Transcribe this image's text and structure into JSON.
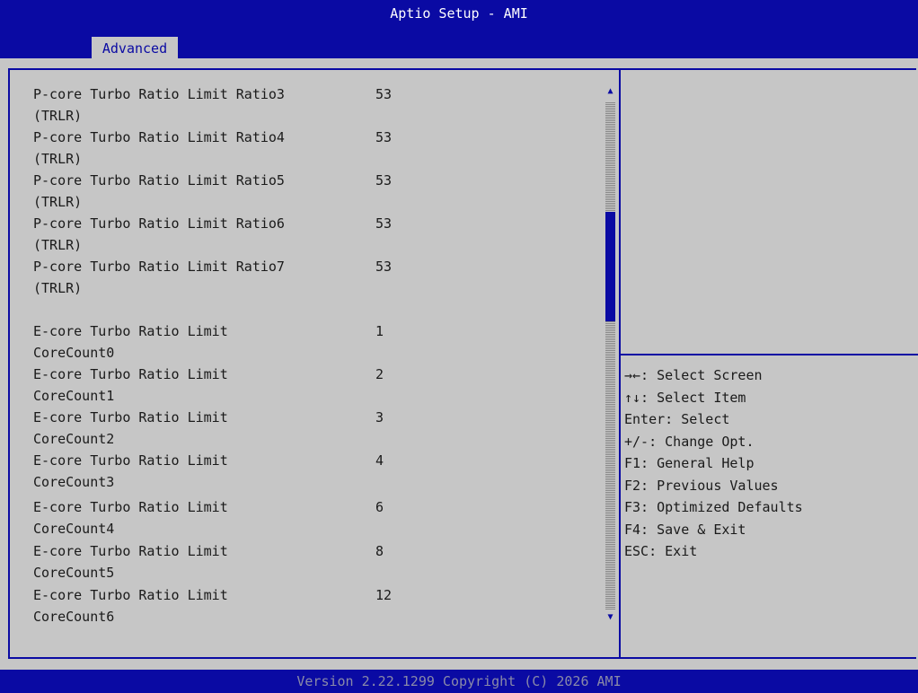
{
  "window": {
    "title": "Aptio Setup - AMI"
  },
  "tabs": [
    {
      "label": "Advanced"
    }
  ],
  "settings": [
    {
      "label": "P-core Turbo Ratio Limit Ratio3\n(TRLR)",
      "value": "53"
    },
    {
      "label": "P-core Turbo Ratio Limit Ratio4\n(TRLR)",
      "value": "53"
    },
    {
      "label": "P-core Turbo Ratio Limit Ratio5\n(TRLR)",
      "value": "53"
    },
    {
      "label": "P-core Turbo Ratio Limit Ratio6\n(TRLR)",
      "value": "53"
    },
    {
      "label": "P-core Turbo Ratio Limit Ratio7\n(TRLR)",
      "value": "53"
    },
    {
      "label": "E-core Turbo Ratio Limit\nCoreCount0",
      "value": "1"
    },
    {
      "label": "E-core Turbo Ratio Limit\nCoreCount1",
      "value": "2"
    },
    {
      "label": "E-core Turbo Ratio Limit\nCoreCount2",
      "value": "3"
    },
    {
      "label": "E-core Turbo Ratio Limit\nCoreCount3",
      "value": "4"
    },
    {
      "label": "E-core Turbo Ratio Limit\nCoreCount4",
      "value": "6"
    },
    {
      "label": "E-core Turbo Ratio Limit\nCoreCount5",
      "value": "8"
    },
    {
      "label": "E-core Turbo Ratio Limit\nCoreCount6",
      "value": "12"
    }
  ],
  "scrollbar": {
    "up_arrow": "▲",
    "down_arrow": "▼",
    "position_fraction": 0.25
  },
  "help": [
    "→←: Select Screen",
    "↑↓: Select Item",
    "Enter: Select",
    "+/-: Change Opt.",
    "F1: General Help",
    "F2: Previous Values",
    "F3: Optimized Defaults",
    "F4: Save & Exit",
    "ESC: Exit"
  ],
  "footer": {
    "version": "Version 2.22.1299 Copyright (C) 2026 AMI"
  },
  "colors": {
    "accent": "#0a0aa3",
    "background": "#c6c6c6",
    "text": "#1a1a1a",
    "footer_text": "#8a8aa8"
  }
}
